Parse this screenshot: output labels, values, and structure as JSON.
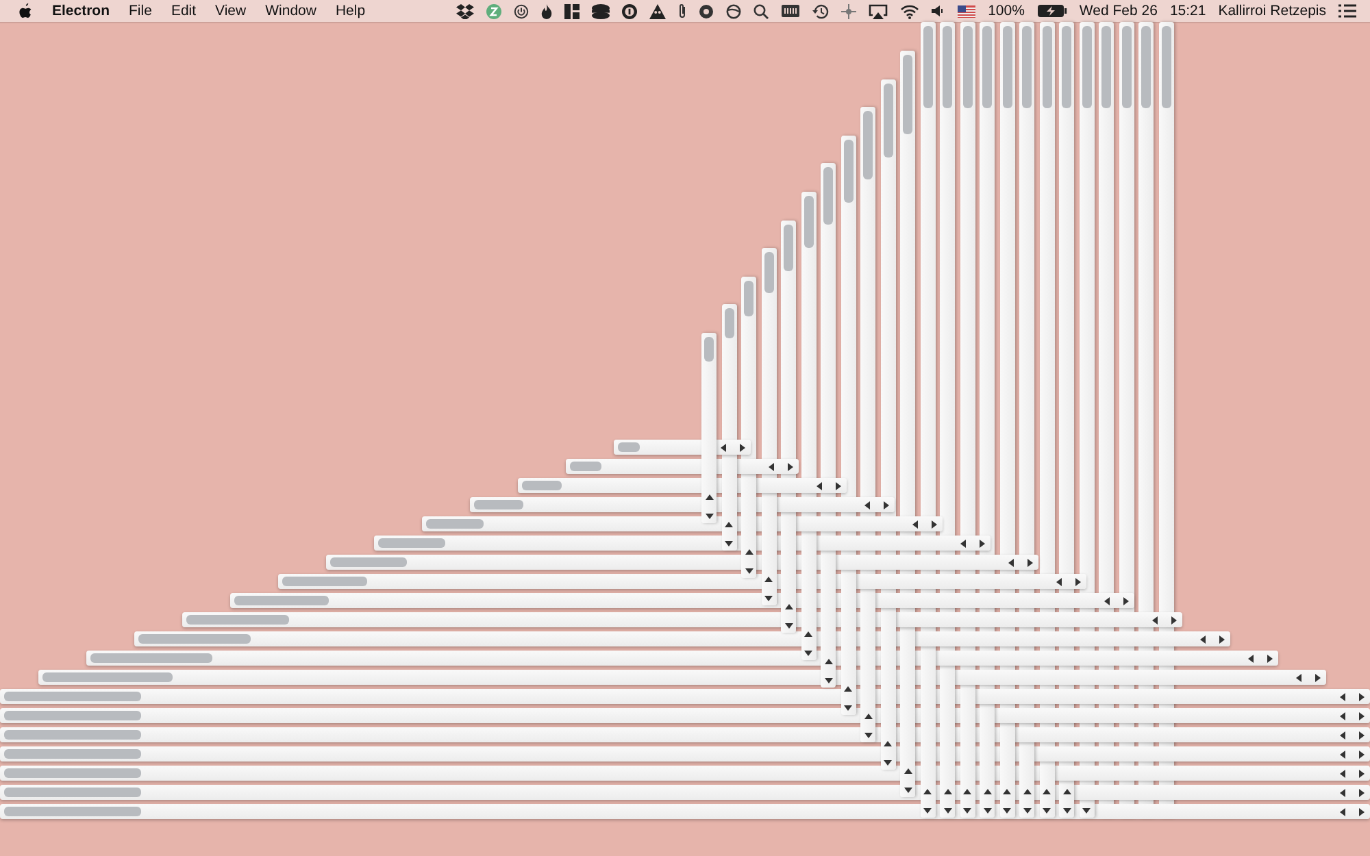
{
  "menu_bar": {
    "app_name": "Electron",
    "menus": [
      "File",
      "Edit",
      "View",
      "Window",
      "Help"
    ],
    "battery_percent": "100%",
    "date": "Wed Feb 26",
    "time": "15:21",
    "user_name": "Kallirroi Retzepis"
  }
}
